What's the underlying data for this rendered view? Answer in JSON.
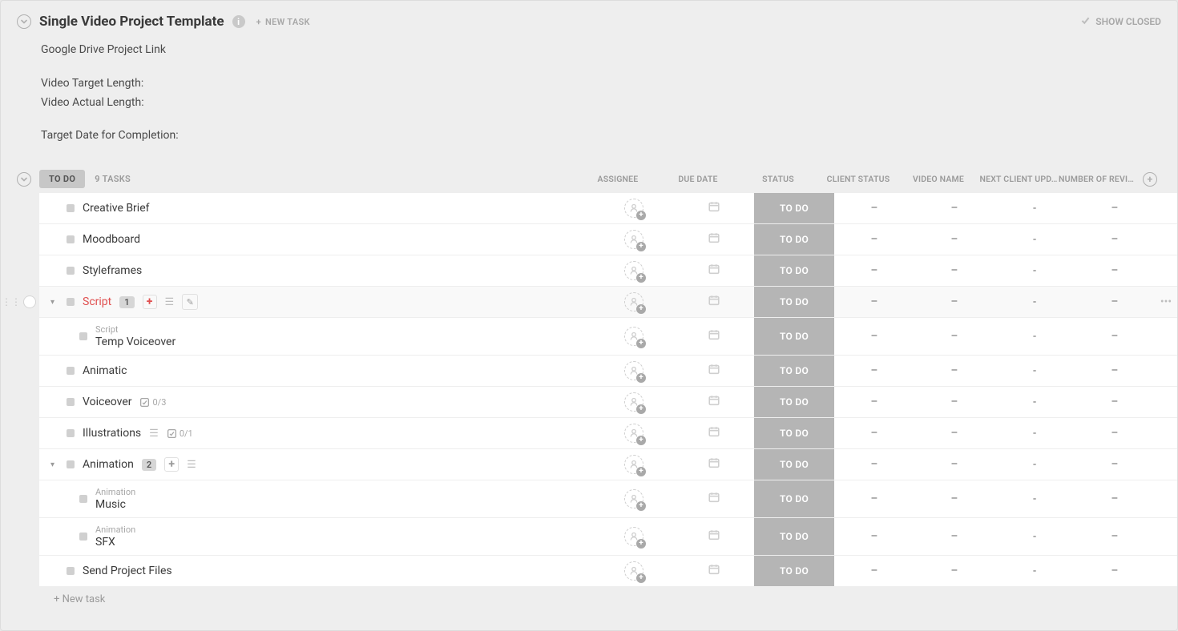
{
  "header": {
    "title": "Single Video Project Template",
    "new_task_label": "NEW TASK",
    "show_closed_label": "SHOW CLOSED"
  },
  "description": {
    "line1": "Google Drive Project Link",
    "line2": "Video Target Length:",
    "line3": "Video Actual Length:",
    "line4": "Target Date for Completion:"
  },
  "group": {
    "status_label": "TO DO",
    "task_count": "9 TASKS",
    "columns": {
      "assignee": "ASSIGNEE",
      "due": "DUE DATE",
      "status": "STATUS",
      "client": "CLIENT STATUS",
      "video": "VIDEO NAME",
      "next": "NEXT CLIENT UPD…",
      "revis": "NUMBER OF REVIS…"
    }
  },
  "tasks": [
    {
      "name": "Creative Brief",
      "status": "TO DO",
      "client": "–",
      "video": "–",
      "next": "-",
      "revis": "–"
    },
    {
      "name": "Moodboard",
      "status": "TO DO",
      "client": "–",
      "video": "–",
      "next": "-",
      "revis": "–"
    },
    {
      "name": "Styleframes",
      "status": "TO DO",
      "client": "–",
      "video": "–",
      "next": "-",
      "revis": "–"
    },
    {
      "name": "Script",
      "status": "TO DO",
      "client": "–",
      "video": "–",
      "next": "-",
      "revis": "–",
      "highlight": true,
      "sub_count": "1",
      "hovered": true,
      "show_toolbar": true
    },
    {
      "name": "Temp Voiceover",
      "status": "TO DO",
      "parent": "Script",
      "client": "–",
      "video": "–",
      "next": "-",
      "revis": "–",
      "is_sub": true
    },
    {
      "name": "Animatic",
      "status": "TO DO",
      "client": "–",
      "video": "–",
      "next": "-",
      "revis": "–"
    },
    {
      "name": "Voiceover",
      "status": "TO DO",
      "client": "–",
      "video": "–",
      "next": "-",
      "revis": "–",
      "checklist": "0/3"
    },
    {
      "name": "Illustrations",
      "status": "TO DO",
      "client": "–",
      "video": "–",
      "next": "-",
      "revis": "–",
      "desc": true,
      "checklist": "0/1"
    },
    {
      "name": "Animation",
      "status": "TO DO",
      "client": "–",
      "video": "–",
      "next": "-",
      "revis": "–",
      "sub_count": "2",
      "expanded": true,
      "show_add_grey": true
    },
    {
      "name": "Music",
      "status": "TO DO",
      "parent": "Animation",
      "client": "–",
      "video": "–",
      "next": "-",
      "revis": "–",
      "is_sub": true
    },
    {
      "name": "SFX",
      "status": "TO DO",
      "parent": "Animation",
      "client": "–",
      "video": "–",
      "next": "-",
      "revis": "–",
      "is_sub": true
    },
    {
      "name": "Send Project Files",
      "status": "TO DO",
      "client": "–",
      "video": "–",
      "next": "-",
      "revis": "–"
    }
  ],
  "footer": {
    "new_task": "+ New task"
  },
  "icons": {
    "more": "•••"
  }
}
